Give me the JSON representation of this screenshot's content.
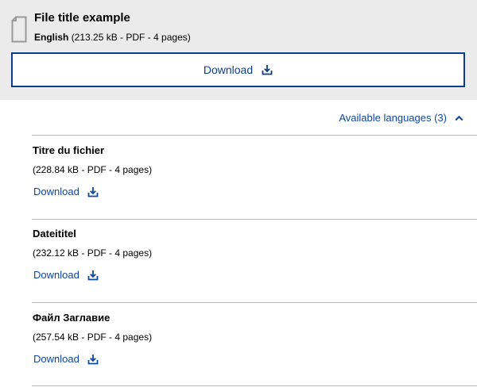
{
  "file": {
    "title": "File title example",
    "language": "English",
    "details": "(213.25 kB - PDF - 4 pages)",
    "download_label": "Download"
  },
  "languages_toggle": {
    "label": "Available languages (3)",
    "expanded": true
  },
  "languages": [
    {
      "title": "Titre du fichier",
      "details": "(228.84 kB - PDF - 4 pages)",
      "download_label": "Download"
    },
    {
      "title": "Dateititel",
      "details": "(232.12 kB - PDF - 4 pages)",
      "download_label": "Download"
    },
    {
      "title": "Файл Заглавие",
      "details": "(257.54 kB - PDF - 4 pages)",
      "download_label": "Download"
    }
  ],
  "icons": {
    "file": "file-icon",
    "download": "download-icon",
    "toggle": "chevron-up-icon"
  },
  "colors": {
    "card_background": "#ebebeb",
    "accent": "#0e3d8c",
    "link": "#0e47a1",
    "divider": "#b7b7b7",
    "file_icon": "#9a9a9a"
  }
}
